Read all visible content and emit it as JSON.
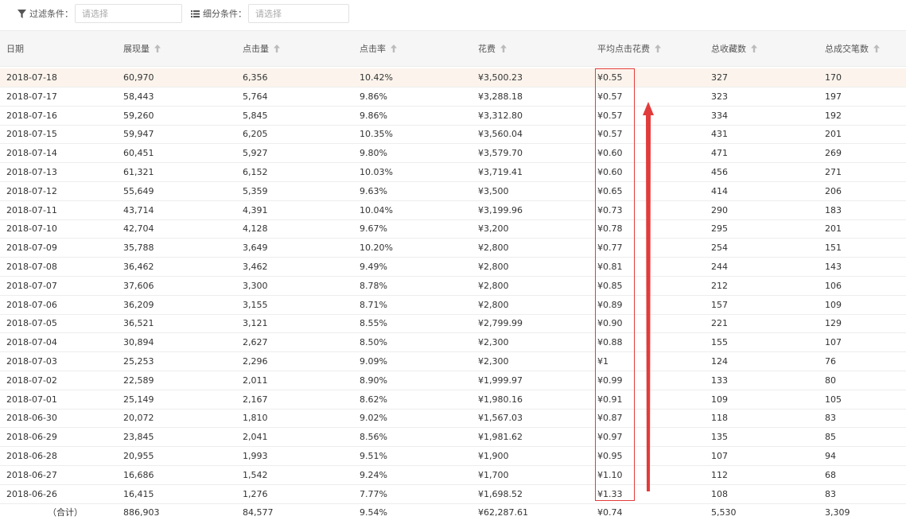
{
  "filter": {
    "filter_label": "过滤条件：",
    "filter_placeholder": "请选择",
    "segment_label": "细分条件：",
    "segment_placeholder": "请选择"
  },
  "columns": [
    "日期",
    "展现量",
    "点击量",
    "点击率",
    "花费",
    "平均点击花费",
    "总收藏数",
    "总成交笔数"
  ],
  "rows": [
    [
      "2018-07-18",
      "60,970",
      "6,356",
      "10.42%",
      "¥3,500.23",
      "¥0.55",
      "327",
      "170"
    ],
    [
      "2018-07-17",
      "58,443",
      "5,764",
      "9.86%",
      "¥3,288.18",
      "¥0.57",
      "323",
      "197"
    ],
    [
      "2018-07-16",
      "59,260",
      "5,845",
      "9.86%",
      "¥3,312.80",
      "¥0.57",
      "334",
      "192"
    ],
    [
      "2018-07-15",
      "59,947",
      "6,205",
      "10.35%",
      "¥3,560.04",
      "¥0.57",
      "431",
      "201"
    ],
    [
      "2018-07-14",
      "60,451",
      "5,927",
      "9.80%",
      "¥3,579.70",
      "¥0.60",
      "471",
      "269"
    ],
    [
      "2018-07-13",
      "61,321",
      "6,152",
      "10.03%",
      "¥3,719.41",
      "¥0.60",
      "456",
      "271"
    ],
    [
      "2018-07-12",
      "55,649",
      "5,359",
      "9.63%",
      "¥3,500",
      "¥0.65",
      "414",
      "206"
    ],
    [
      "2018-07-11",
      "43,714",
      "4,391",
      "10.04%",
      "¥3,199.96",
      "¥0.73",
      "290",
      "183"
    ],
    [
      "2018-07-10",
      "42,704",
      "4,128",
      "9.67%",
      "¥3,200",
      "¥0.78",
      "295",
      "201"
    ],
    [
      "2018-07-09",
      "35,788",
      "3,649",
      "10.20%",
      "¥2,800",
      "¥0.77",
      "254",
      "151"
    ],
    [
      "2018-07-08",
      "36,462",
      "3,462",
      "9.49%",
      "¥2,800",
      "¥0.81",
      "244",
      "143"
    ],
    [
      "2018-07-07",
      "37,606",
      "3,300",
      "8.78%",
      "¥2,800",
      "¥0.85",
      "212",
      "106"
    ],
    [
      "2018-07-06",
      "36,209",
      "3,155",
      "8.71%",
      "¥2,800",
      "¥0.89",
      "157",
      "109"
    ],
    [
      "2018-07-05",
      "36,521",
      "3,121",
      "8.55%",
      "¥2,799.99",
      "¥0.90",
      "221",
      "129"
    ],
    [
      "2018-07-04",
      "30,894",
      "2,627",
      "8.50%",
      "¥2,300",
      "¥0.88",
      "155",
      "107"
    ],
    [
      "2018-07-03",
      "25,253",
      "2,296",
      "9.09%",
      "¥2,300",
      "¥1",
      "124",
      "76"
    ],
    [
      "2018-07-02",
      "22,589",
      "2,011",
      "8.90%",
      "¥1,999.97",
      "¥0.99",
      "133",
      "80"
    ],
    [
      "2018-07-01",
      "25,149",
      "2,167",
      "8.62%",
      "¥1,980.16",
      "¥0.91",
      "109",
      "105"
    ],
    [
      "2018-06-30",
      "20,072",
      "1,810",
      "9.02%",
      "¥1,567.03",
      "¥0.87",
      "118",
      "83"
    ],
    [
      "2018-06-29",
      "23,845",
      "2,041",
      "8.56%",
      "¥1,981.62",
      "¥0.97",
      "135",
      "85"
    ],
    [
      "2018-06-28",
      "20,955",
      "1,993",
      "9.51%",
      "¥1,900",
      "¥0.95",
      "107",
      "94"
    ],
    [
      "2018-06-27",
      "16,686",
      "1,542",
      "9.24%",
      "¥1,700",
      "¥1.10",
      "112",
      "68"
    ],
    [
      "2018-06-26",
      "16,415",
      "1,276",
      "7.77%",
      "¥1,698.52",
      "¥1.33",
      "108",
      "83"
    ]
  ],
  "total": [
    "（合计）",
    "886,903",
    "84,577",
    "9.54%",
    "¥62,287.61",
    "¥0.74",
    "5,530",
    "3,309"
  ],
  "colors": {
    "highlight_row": "#fcf4ec",
    "annotation_red": "#e23b3b",
    "header_bg": "#f6f6f6"
  },
  "icons": {
    "filter": "funnel-icon",
    "segment": "list-icon",
    "sort": "sort-up-icon"
  }
}
